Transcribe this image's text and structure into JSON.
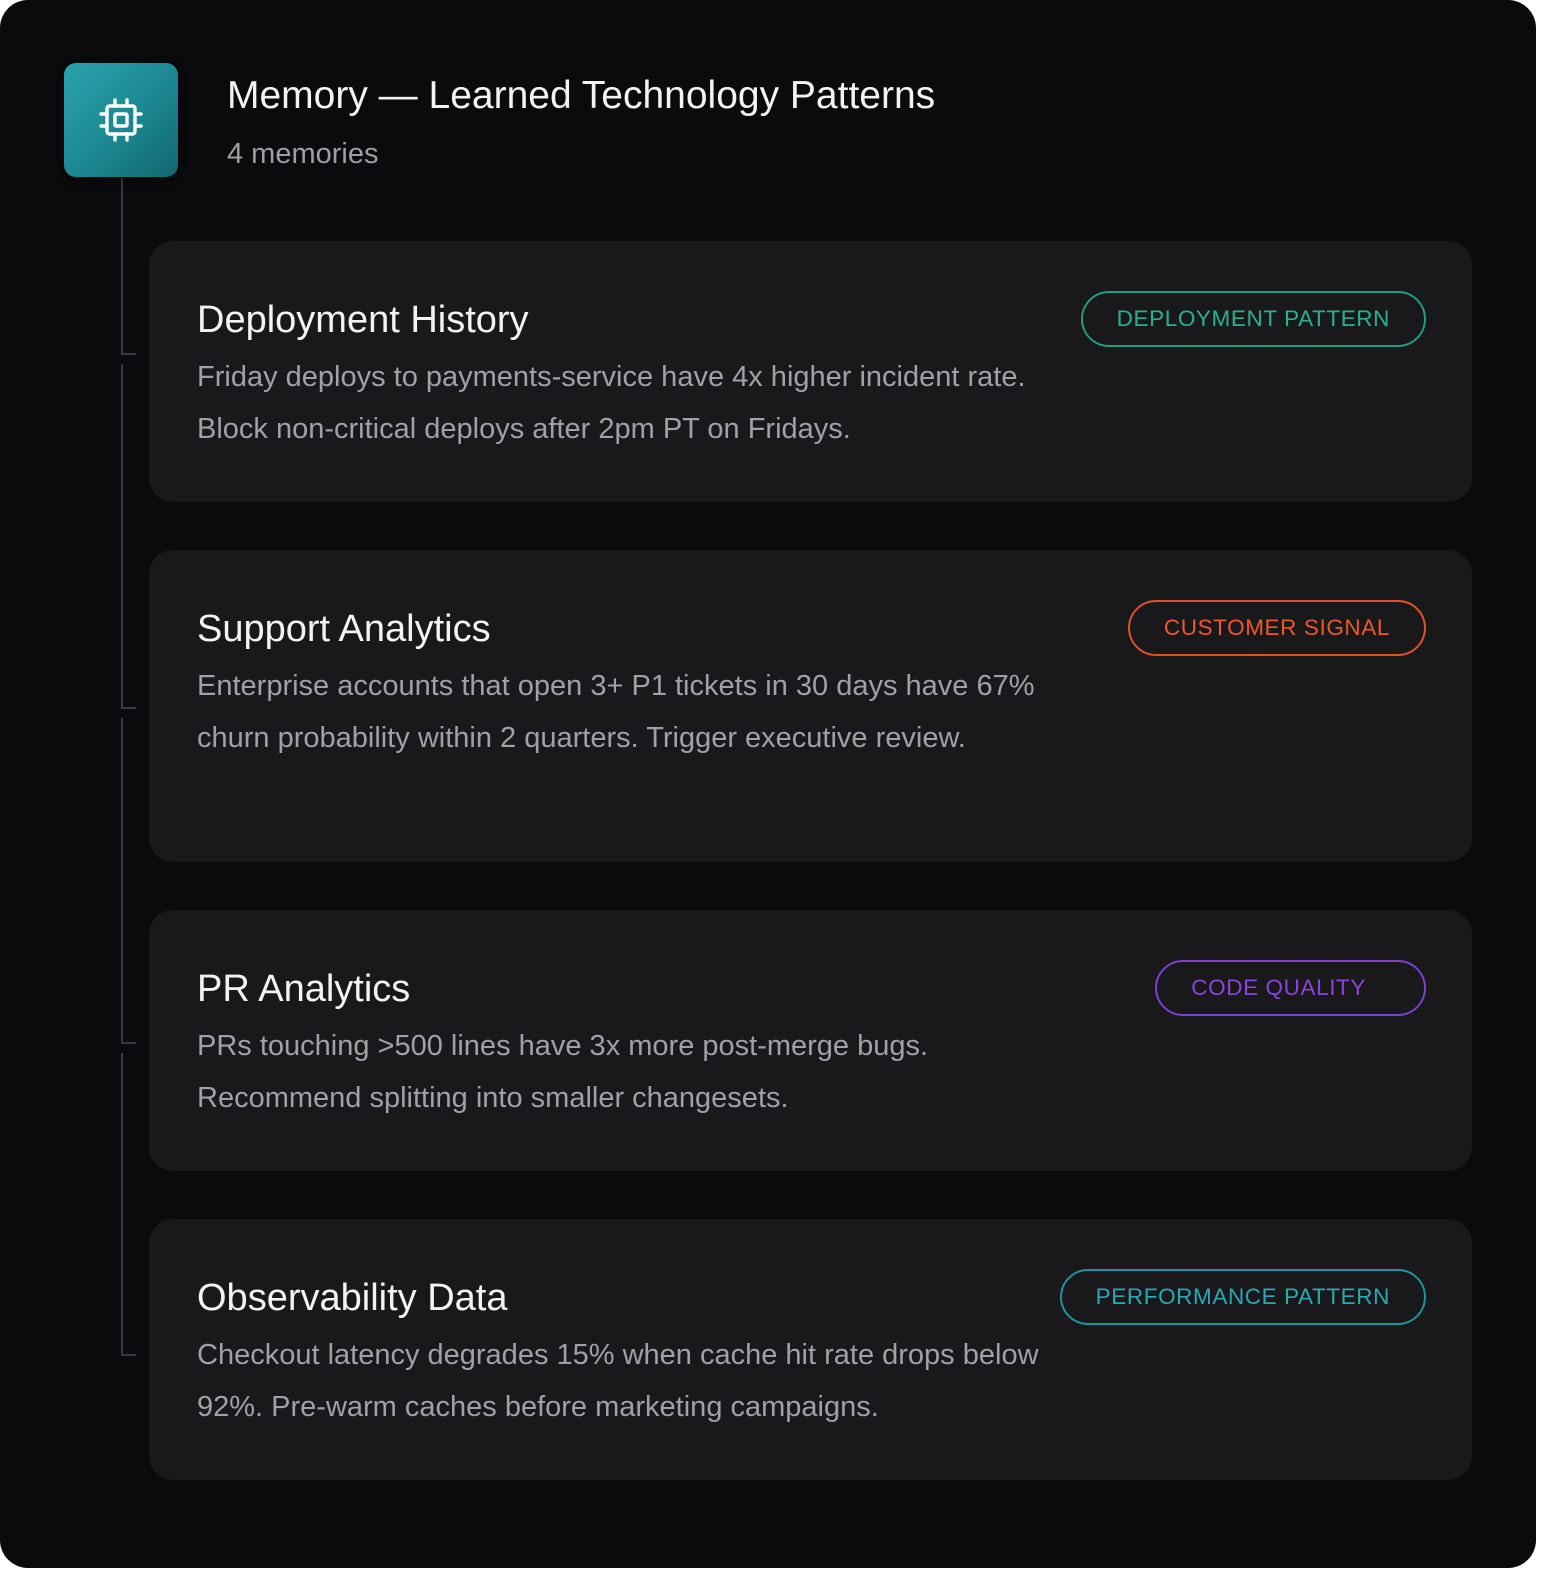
{
  "header": {
    "title": "Memory — Learned Technology Patterns",
    "subtitle": "4 memories",
    "icon": "cpu-chip-icon",
    "icon_color": "#1f929b"
  },
  "memories": [
    {
      "title": "Deployment History",
      "description": "Friday deploys to payments-service have 4x higher incident rate. Block non-critical deploys after 2pm PT on Fridays.",
      "tag": "DEPLOYMENT PATTERN",
      "tag_color": "#27b38a"
    },
    {
      "title": "Support Analytics",
      "description": "Enterprise accounts that open 3+ P1 tickets in 30 days have 67% churn probability within 2 quarters. Trigger executive review.",
      "tag": "CUSTOMER SIGNAL",
      "tag_color": "#f1552a"
    },
    {
      "title": "PR Analytics",
      "description": "PRs touching >500 lines have 3x more post-merge bugs. Recommend splitting into smaller changesets.",
      "tag": "CODE QUALITY",
      "tag_color": "#8a44dd"
    },
    {
      "title": "Observability Data",
      "description": "Checkout latency degrades 15% when cache hit rate drops below 92%. Pre-warm caches before marketing campaigns.",
      "tag": "PERFORMANCE PATTERN",
      "tag_color": "#2aa9b3"
    }
  ]
}
